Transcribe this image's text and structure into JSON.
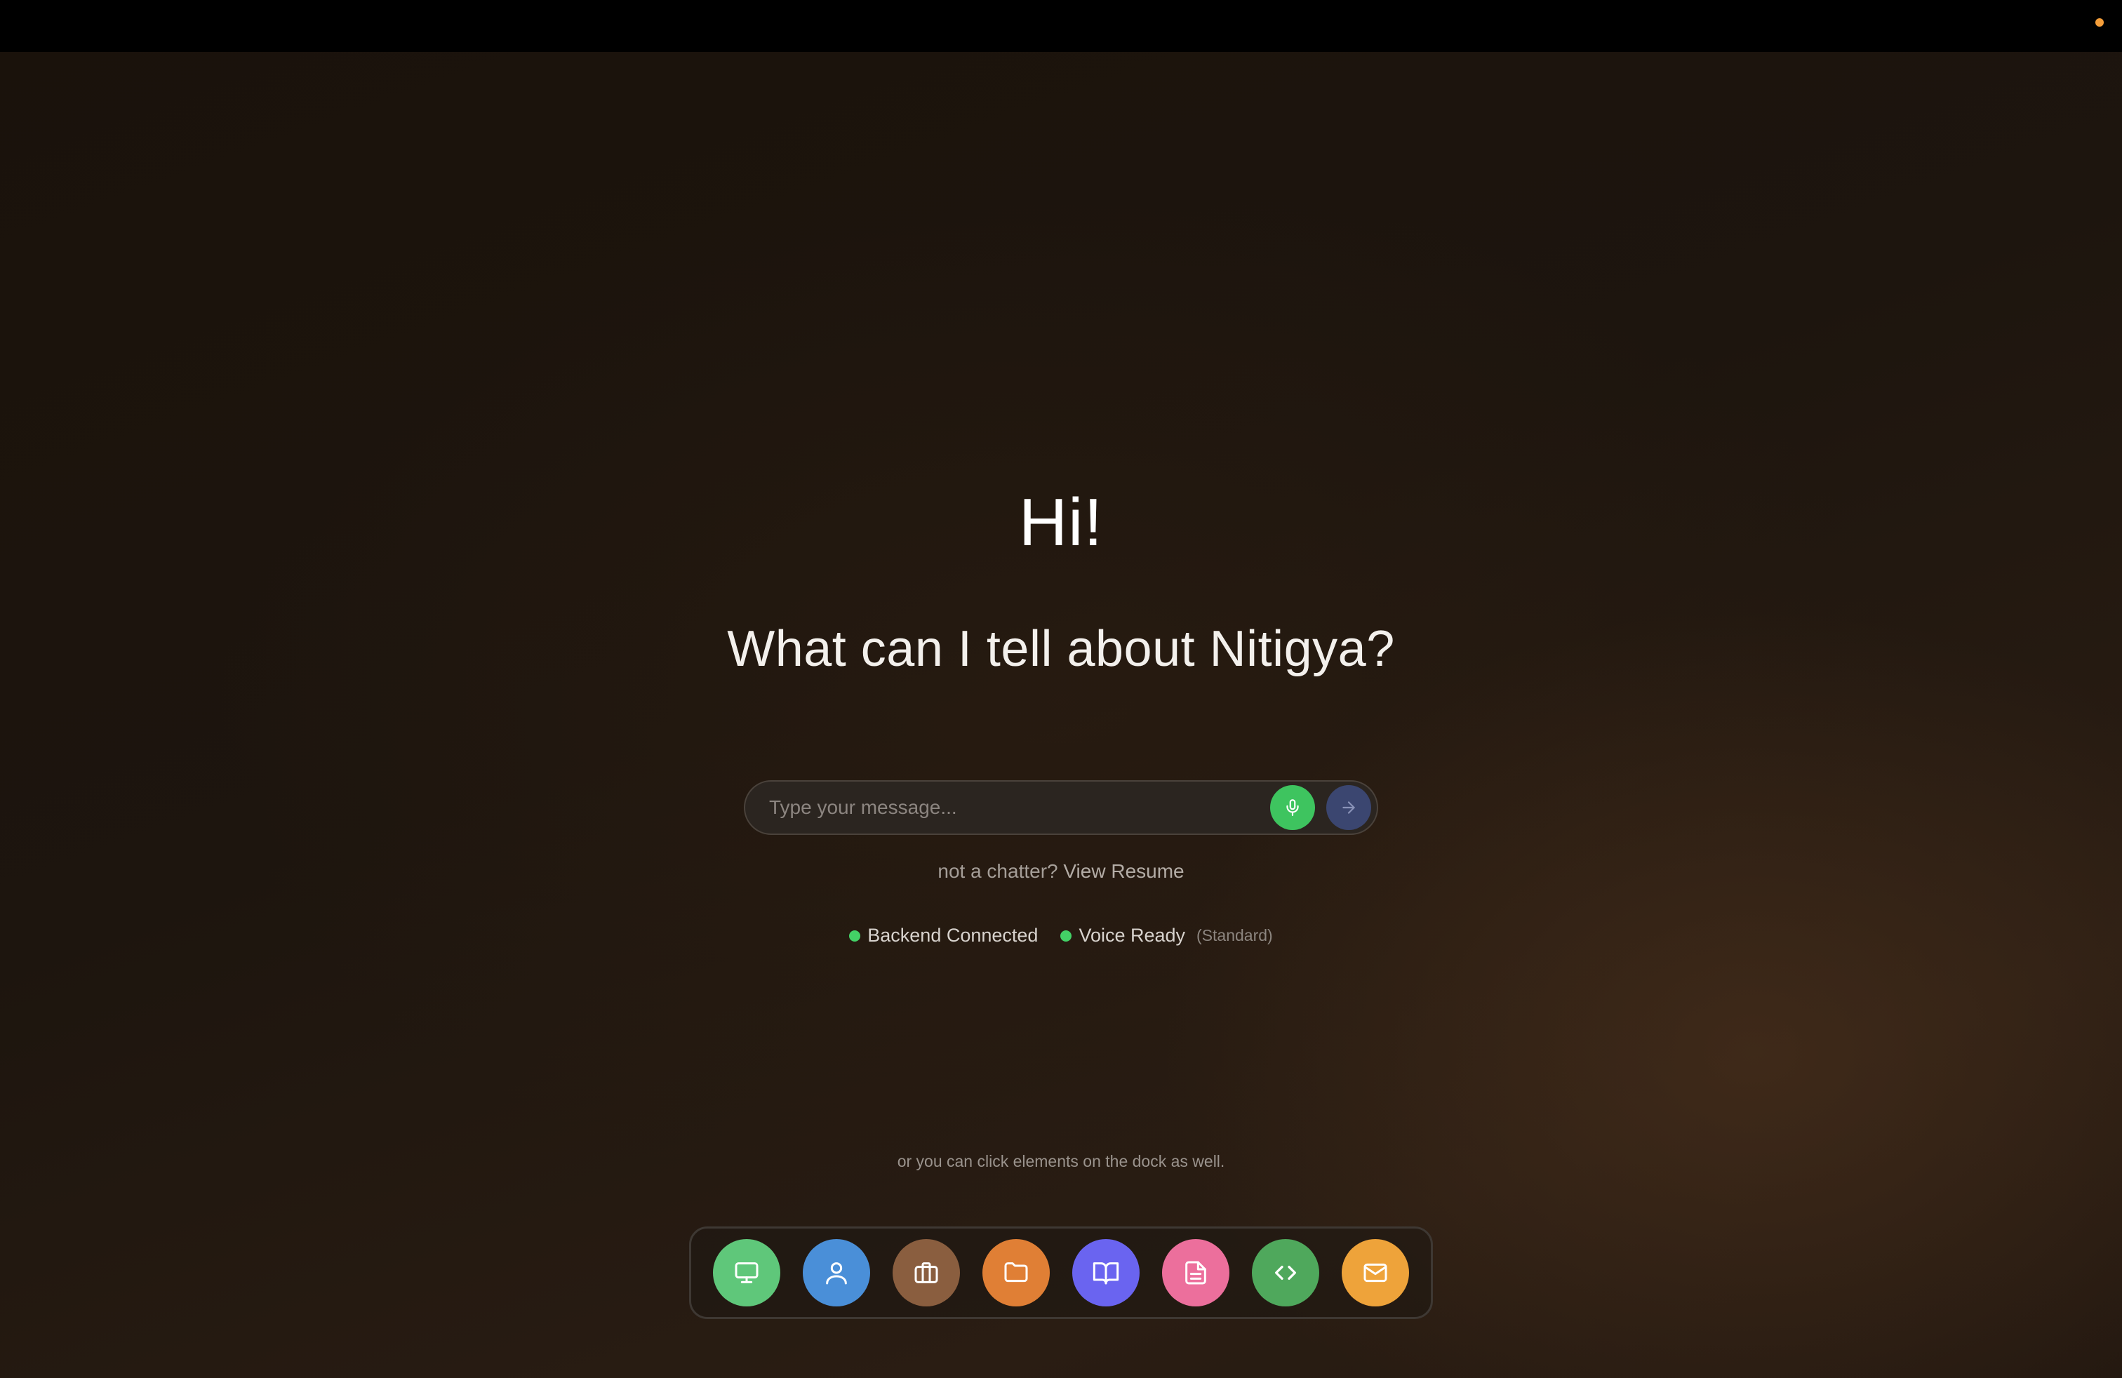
{
  "greeting": "Hi!",
  "subtitle": "What can I tell about Nitigya?",
  "chat": {
    "placeholder": "Type your message...",
    "value": "",
    "mic_icon": "microphone-icon",
    "send_icon": "arrow-right-icon"
  },
  "resume": {
    "prefix": "not a chatter?",
    "link": "View Resume"
  },
  "statuses": {
    "backend": "Backend Connected",
    "voice": "Voice Ready",
    "voice_mode": "(Standard)"
  },
  "dock_hint": "or you can click elements on the dock as well.",
  "colors": {
    "topbar": "#000000",
    "status_dot": "#f59e3a",
    "mic": "#3ec45f",
    "send": "#3b4670",
    "connected": "#43d166"
  },
  "dock": [
    {
      "icon": "monitor-icon",
      "color": "#5fc77a"
    },
    {
      "icon": "user-icon",
      "color": "#4a8fd8"
    },
    {
      "icon": "briefcase-icon",
      "color": "#8a5e3f"
    },
    {
      "icon": "folder-icon",
      "color": "#e07f35"
    },
    {
      "icon": "book-open-icon",
      "color": "#6a64f0"
    },
    {
      "icon": "document-icon",
      "color": "#ec6f9c"
    },
    {
      "icon": "code-icon",
      "color": "#4fa85c"
    },
    {
      "icon": "mail-icon",
      "color": "#eea33a"
    }
  ]
}
